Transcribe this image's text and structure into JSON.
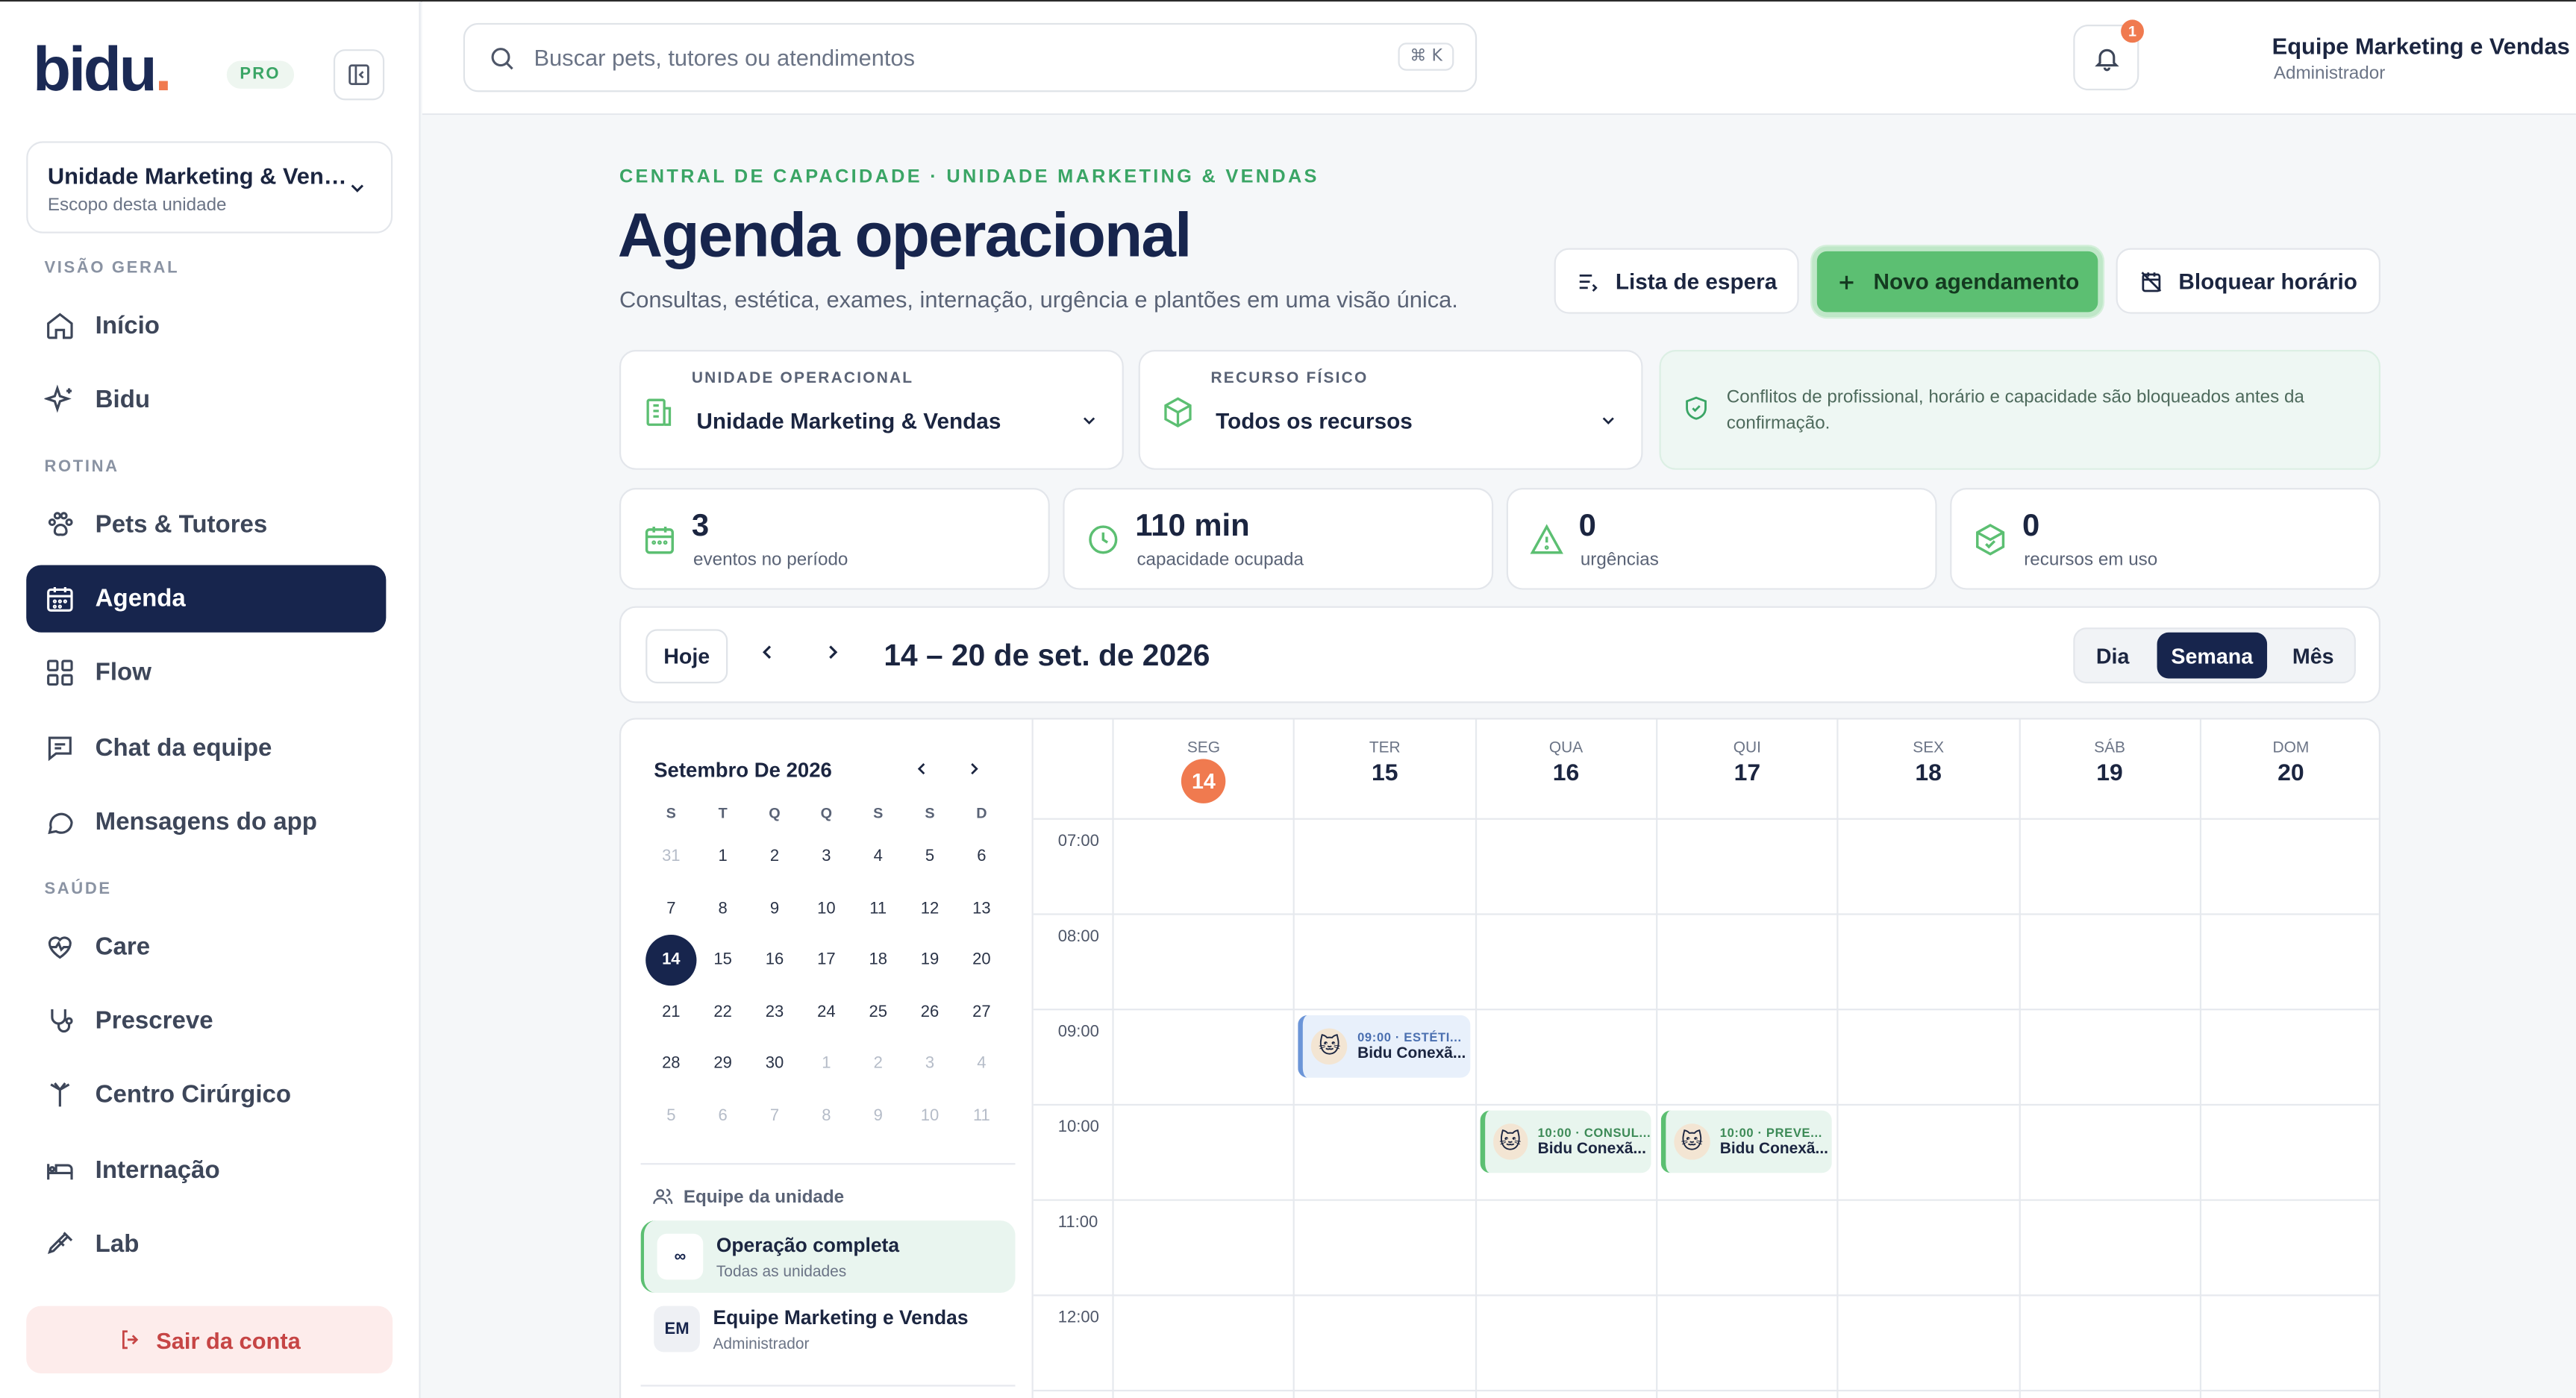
{
  "brand": {
    "logo": "bidu",
    "badge": "PRO"
  },
  "unit_selector": {
    "title": "Unidade Marketing & Vend...",
    "subtitle": "Escopo desta unidade"
  },
  "sidebar": {
    "sections": [
      "VISÃO GERAL",
      "ROTINA",
      "SAÚDE"
    ],
    "items": [
      {
        "label": "Início",
        "icon": "home-icon"
      },
      {
        "label": "Bidu",
        "icon": "sparkles-icon"
      },
      {
        "label": "Pets & Tutores",
        "icon": "paw-icon"
      },
      {
        "label": "Agenda",
        "icon": "calendar-icon",
        "active": true
      },
      {
        "label": "Flow",
        "icon": "grid-icon"
      },
      {
        "label": "Chat da equipe",
        "icon": "chat-icon"
      },
      {
        "label": "Mensagens do app",
        "icon": "message-icon"
      },
      {
        "label": "Care",
        "icon": "heart-pulse-icon"
      },
      {
        "label": "Prescreve",
        "icon": "stethoscope-icon"
      },
      {
        "label": "Centro Cirúrgico",
        "icon": "surgery-icon"
      },
      {
        "label": "Internação",
        "icon": "bed-icon"
      },
      {
        "label": "Lab",
        "icon": "pipette-icon"
      }
    ],
    "logout": "Sair da conta"
  },
  "search": {
    "placeholder": "Buscar pets, tutores ou atendimentos",
    "shortcut": "⌘ K"
  },
  "notifications": {
    "count": "1"
  },
  "user": {
    "name": "Equipe Marketing e Vendas",
    "role": "Administrador"
  },
  "header": {
    "eyebrow": "CENTRAL DE CAPACIDADE · UNIDADE MARKETING & VENDAS",
    "title": "Agenda operacional",
    "subtitle": "Consultas, estética, exames, internação, urgência e plantões em uma visão única.",
    "waitlist": "Lista de espera",
    "new_appointment": "Novo agendamento",
    "block_time": "Bloquear horário"
  },
  "filters": {
    "unit_label": "UNIDADE OPERACIONAL",
    "unit_value": "Unidade Marketing & Vendas",
    "resource_label": "RECURSO FÍSICO",
    "resource_value": "Todos os recursos",
    "notice": "Conflitos de profissional, horário e capacidade são bloqueados antes da confirmação."
  },
  "stats": [
    {
      "value": "3",
      "label": "eventos no período"
    },
    {
      "value": "110 min",
      "label": "capacidade ocupada"
    },
    {
      "value": "0",
      "label": "urgências"
    },
    {
      "value": "0",
      "label": "recursos em uso"
    }
  ],
  "toolbar": {
    "today": "Hoje",
    "range": "14 – 20 de set. de 2026",
    "views": [
      "Dia",
      "Semana",
      "Mês"
    ],
    "active_view": "Semana"
  },
  "mini_calendar": {
    "title": "Setembro De 2026",
    "dow": [
      "S",
      "T",
      "Q",
      "Q",
      "S",
      "S",
      "D"
    ],
    "weeks": [
      [
        "31",
        "1",
        "2",
        "3",
        "4",
        "5",
        "6"
      ],
      [
        "7",
        "8",
        "9",
        "10",
        "11",
        "12",
        "13"
      ],
      [
        "14",
        "15",
        "16",
        "17",
        "18",
        "19",
        "20"
      ],
      [
        "21",
        "22",
        "23",
        "24",
        "25",
        "26",
        "27"
      ],
      [
        "28",
        "29",
        "30",
        "1",
        "2",
        "3",
        "4"
      ],
      [
        "5",
        "6",
        "7",
        "8",
        "9",
        "10",
        "11"
      ]
    ],
    "selected": "14"
  },
  "team": {
    "heading": "Equipe da unidade",
    "members": [
      {
        "initials": "∞",
        "name": "Operação completa",
        "sub": "Todas as unidades",
        "active": true
      },
      {
        "initials": "EM",
        "name": "Equipe Marketing e Vendas",
        "sub": "Administrador",
        "active": false
      }
    ]
  },
  "week": {
    "days": [
      {
        "dow": "SEG",
        "num": "14",
        "today": true
      },
      {
        "dow": "TER",
        "num": "15"
      },
      {
        "dow": "QUA",
        "num": "16"
      },
      {
        "dow": "QUI",
        "num": "17"
      },
      {
        "dow": "SEX",
        "num": "18"
      },
      {
        "dow": "SÁB",
        "num": "19"
      },
      {
        "dow": "DOM",
        "num": "20"
      }
    ],
    "hours": [
      "07:00",
      "08:00",
      "09:00",
      "10:00",
      "11:00",
      "12:00"
    ],
    "events": [
      {
        "day": 1,
        "hour": "09:00",
        "time": "09:00 · ESTÉTI...",
        "title": "Bidu Conexã...",
        "color": "blue"
      },
      {
        "day": 2,
        "hour": "10:00",
        "time": "10:00 · CONSUL...",
        "title": "Bidu Conexã...",
        "color": "green"
      },
      {
        "day": 3,
        "hour": "10:00",
        "time": "10:00 · PREVE...",
        "title": "Bidu Conexã...",
        "color": "green"
      }
    ]
  }
}
